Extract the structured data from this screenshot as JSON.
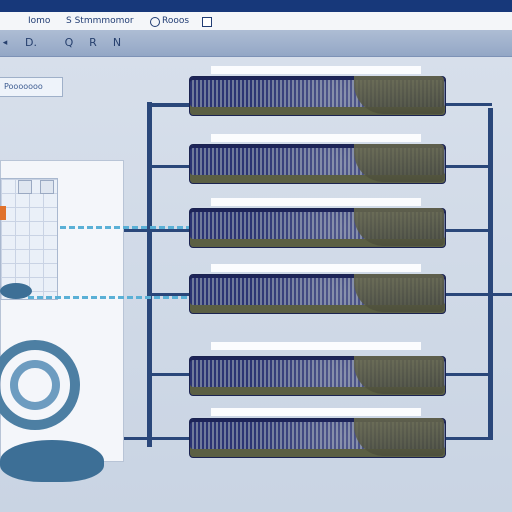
{
  "menu": {
    "items": [
      "Iomo",
      "S Stmmmomor",
      "Rooos"
    ]
  },
  "toolbar": {
    "buttons": [
      "D.",
      "Q",
      "R",
      "N"
    ]
  },
  "panel_tag": "Pooooooo",
  "colors": {
    "title_bar": "#17387a",
    "toolbar": "#a3b4cf",
    "connector": "#2a477a",
    "dashed_link": "#5ab0d6",
    "module_body": "#3a4278",
    "swirl": "#4d7fa3"
  },
  "modules": [
    {
      "id": 1
    },
    {
      "id": 2
    },
    {
      "id": 3
    },
    {
      "id": 4
    },
    {
      "id": 5
    },
    {
      "id": 6
    }
  ]
}
